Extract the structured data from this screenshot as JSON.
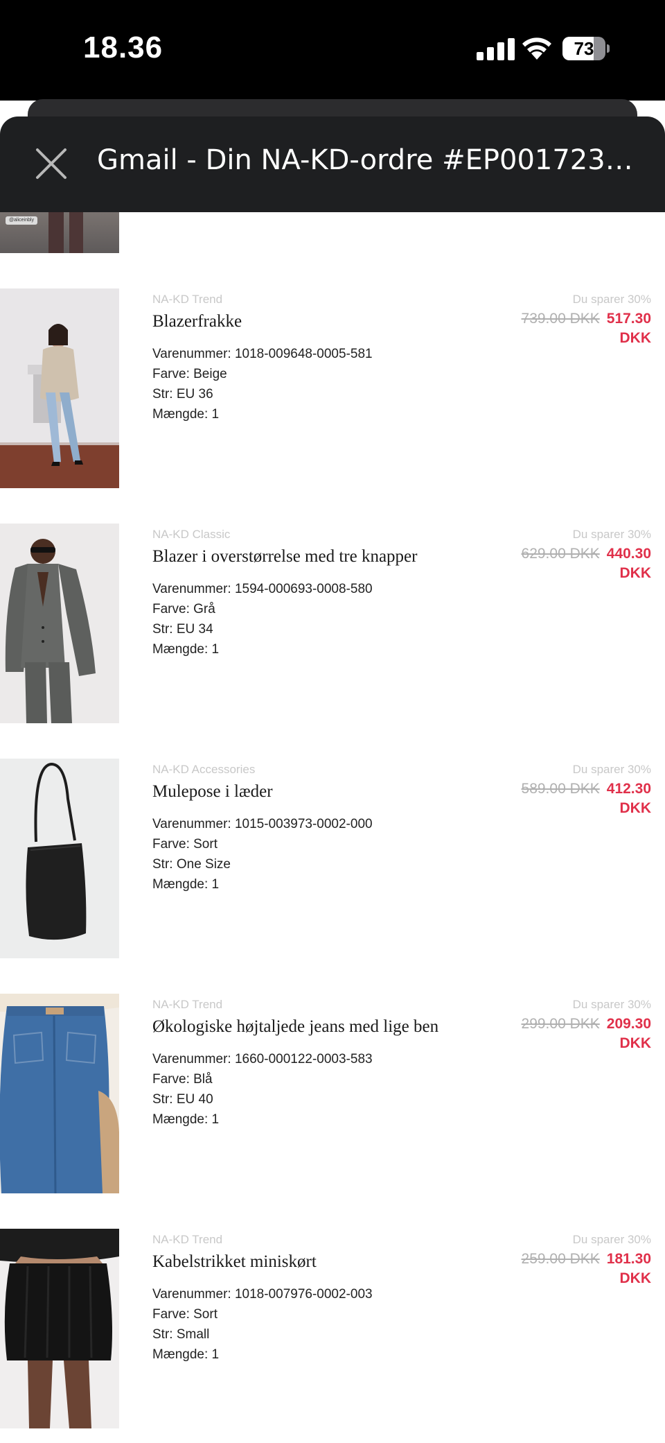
{
  "status_bar": {
    "time": "18.36",
    "battery": "73"
  },
  "header": {
    "title": "Gmail - Din NA-KD-ordre #EP0017236..."
  },
  "labels": {
    "item_number": "Varenummer: ",
    "color": "Farve: ",
    "size": "Str: ",
    "quantity": "Mængde: "
  },
  "items": [
    {
      "brand": "NA-KD Trend",
      "name": "Blazerfrakke",
      "item_number": "1018-009648-0005-581",
      "color": "Beige",
      "size": "EU 36",
      "quantity": "1",
      "savings": "Du sparer 30%",
      "old_price": "739.00 DKK",
      "new_price": "517.30",
      "currency": "DKK"
    },
    {
      "brand": "NA-KD Classic",
      "name": "Blazer i overstørrelse med tre knapper",
      "item_number": "1594-000693-0008-580",
      "color": "Grå",
      "size": "EU 34",
      "quantity": "1",
      "savings": "Du sparer 30%",
      "old_price": "629.00 DKK",
      "new_price": "440.30",
      "currency": "DKK"
    },
    {
      "brand": "NA-KD Accessories",
      "name": "Mulepose i læder",
      "item_number": "1015-003973-0002-000",
      "color": "Sort",
      "size": "One Size",
      "quantity": "1",
      "savings": "Du sparer 30%",
      "old_price": "589.00 DKK",
      "new_price": "412.30",
      "currency": "DKK"
    },
    {
      "brand": "NA-KD Trend",
      "name": "Økologiske højtaljede jeans med lige ben",
      "item_number": "1660-000122-0003-583",
      "color": "Blå",
      "size": "EU 40",
      "quantity": "1",
      "savings": "Du sparer 30%",
      "old_price": "299.00 DKK",
      "new_price": "209.30",
      "currency": "DKK"
    },
    {
      "brand": "NA-KD Trend",
      "name": "Kabelstrikket miniskørt",
      "item_number": "1018-007976-0002-003",
      "color": "Sort",
      "size": "Small",
      "quantity": "1",
      "savings": "Du sparer 30%",
      "old_price": "259.00 DKK",
      "new_price": "181.30",
      "currency": "DKK"
    }
  ],
  "icons": {
    "close": "close-icon",
    "signal": "cellular-signal-icon",
    "wifi": "wifi-icon",
    "battery": "battery-icon"
  },
  "colors": {
    "price_red": "#e0304a",
    "header_bg": "#1e1f21"
  }
}
